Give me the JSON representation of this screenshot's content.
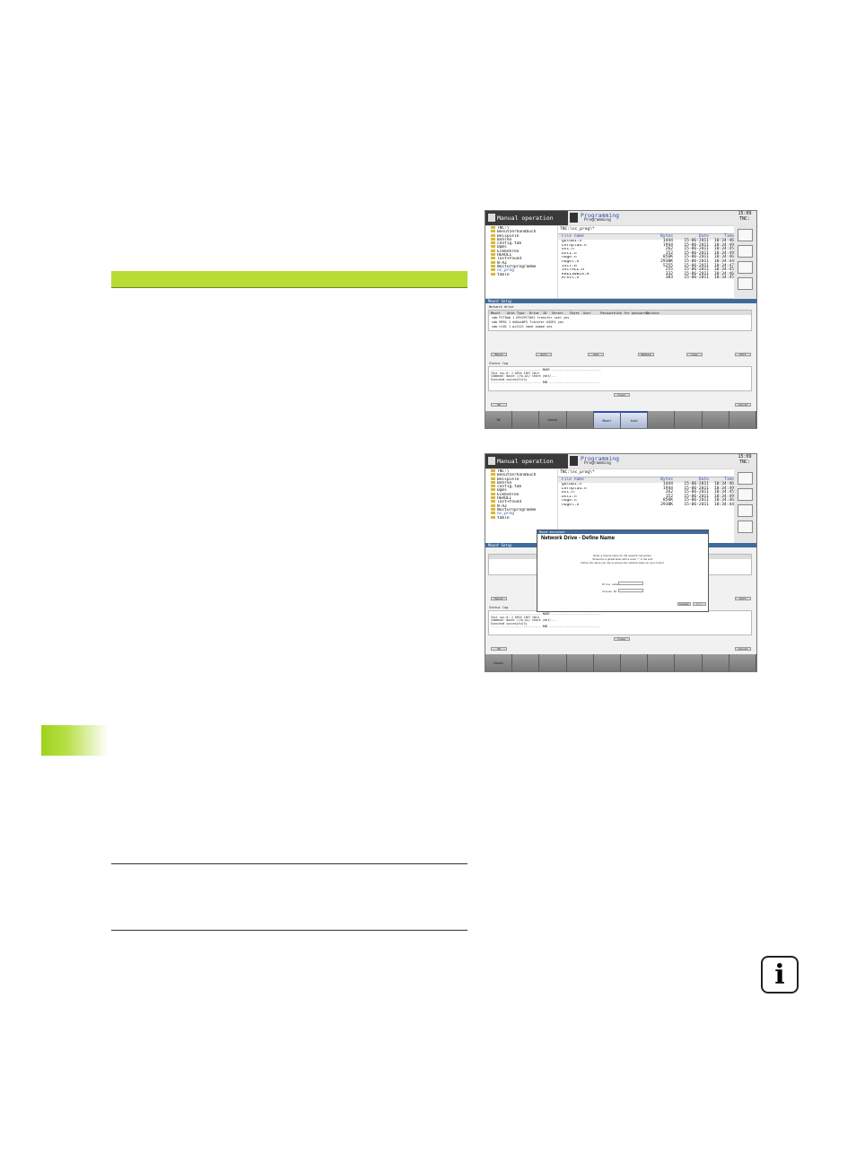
{
  "shot1": {
    "mode_title": "Manual operation",
    "prog_title": "Programming",
    "prog_subtitle": "Programming",
    "clock": "15:09",
    "clock_sub": "TNC:",
    "path": "TNC:\\nc_prog\\*",
    "tree_items": [
      "TNC:\\",
      "Benutzerhandbuch",
      "Beispiele",
      "Bohren",
      "config.tab",
      "Dpms",
      "Eckbohren",
      "HEROLI",
      "lost+found",
      "N-AZ",
      "Nocturnprogramme",
      "nc_prog",
      "table"
    ],
    "file_columns": [
      "File name",
      "Bytes",
      "Status",
      "Date",
      "Time"
    ],
    "files": [
      [
        "gold01.h",
        "1444",
        "15-06-2011",
        "10:34:46"
      ],
      [
        "Lernplau.h",
        "1944",
        "15-06-2011",
        "10:34:49"
      ],
      [
        "bsc.h",
        "262",
        "15-06-2011",
        "10:34:45"
      ],
      [
        "bsc1.h",
        "152",
        "15-06-2011",
        "10:34:49"
      ],
      [
        "huge.h",
        "856K",
        "15-06-2011",
        "10:34:46"
      ],
      [
        "hugel.h",
        "2930K",
        "15-06-2011",
        "10:34:44"
      ],
      [
        "IVCT.H",
        "5255",
        "15-06-2011",
        "10:34:47"
      ],
      [
        "IVCTALL.H",
        "255",
        "15-06-2011",
        "10:34:45"
      ],
      [
        "KREIS0B1S.H",
        "332",
        "15-06-2011",
        "10:34:46"
      ],
      [
        "kreis.h",
        "383",
        "15-06-2011",
        "10:34:45"
      ]
    ],
    "dialog_title": "Mount Setup",
    "network_label": "Network drive",
    "table_headers": [
      "Mount",
      "Auto",
      "Type",
      "Drive",
      "ID",
      "Server",
      "Share",
      "User",
      "Password",
      "Ask for password?",
      "Options"
    ],
    "table_rows": [
      "smb   PCT0ab  1  DEV2PCT001  transfer  user  yes",
      "smb   MP01    1  deDpsNFS  Transfer  USER1  yes",
      "smb   nc01    1  pc2221  nmnb  smpme  yes"
    ],
    "buttons": [
      "Mount",
      "Auto",
      "Add",
      "Remove",
      "Copy",
      "Edit"
    ],
    "log_label": "Status log",
    "log_lines": [
      "----------------------------- BOOM -----------------------------",
      "Test csv-0: 2 0P10 1307 2014",
      "Command: mount //nc-pc/ share /mnt/...",
      "Executed successfully",
      "----------------------------- END -----------------------------"
    ],
    "clear_label": "Clear",
    "ok_label": "OK",
    "cancel_label": "Cancel",
    "softkeys": [
      "OK",
      "",
      "Cancel",
      "",
      "Mount",
      "Auto",
      "",
      "",
      "",
      ""
    ]
  },
  "shot2": {
    "mode_title": "Manual operation",
    "prog_title": "Programming",
    "prog_subtitle": "Programming",
    "clock": "15:09",
    "clock_sub": "TNC:",
    "path": "TNC:\\nc_prog\\*",
    "tree_items": [
      "TNC:\\",
      "Benutzerhandbuch",
      "Beispiele",
      "Bohren",
      "config.tab",
      "Dpms",
      "Eckbohren",
      "HEROLI",
      "lost+found",
      "N-AZ",
      "Nocturnprogramme",
      "nc_prog",
      "table"
    ],
    "file_columns": [
      "File name",
      "Bytes",
      "Status",
      "Date",
      "Time"
    ],
    "files": [
      [
        "gold01.h",
        "1444",
        "15-06-2011",
        "10:34:46"
      ],
      [
        "Lernplau.h",
        "1944",
        "15-06-2011",
        "10:34:49"
      ],
      [
        "bsc.h",
        "262",
        "15-06-2011",
        "10:34:45"
      ],
      [
        "bsc1.h",
        "152",
        "15-06-2011",
        "10:34:49"
      ],
      [
        "huge.h",
        "856K",
        "15-06-2011",
        "10:34:46"
      ],
      [
        "hugel.h",
        "2930K",
        "15-06-2011",
        "10:34:44"
      ]
    ],
    "dialog_title": "Mount Setup",
    "modal_bar": "Mount assistant",
    "modal_title": "Network Drive - Define Name",
    "modal_desc": [
      "Enter a volume name for the network connection.",
      "Should be a global letter with a colon \":\" in the end.",
      "Define the name you use to access the network share on your control."
    ],
    "drive_label": "Drive name",
    "volume_label": "Volume ID",
    "modal_cancel": "Cancel",
    "modal_next": "Next",
    "mount_label": "Mount",
    "edit_label": "Edit",
    "log_label": "Status log",
    "log_lines": [
      "----------------------------- BOOM -----------------------------",
      "Test csv-0: 2 0P10 1307 2014",
      "Command: mount //nc-pc/ share /mnt/...",
      "Executed successfully",
      "----------------------------- END -----------------------------"
    ],
    "clear_label": "Clear",
    "ok_label": "OK",
    "cancel_label": "Cancel",
    "softkeys": [
      "Cancel",
      "",
      "",
      "",
      "",
      "",
      "",
      "",
      "",
      ""
    ]
  },
  "info_icon": "i"
}
